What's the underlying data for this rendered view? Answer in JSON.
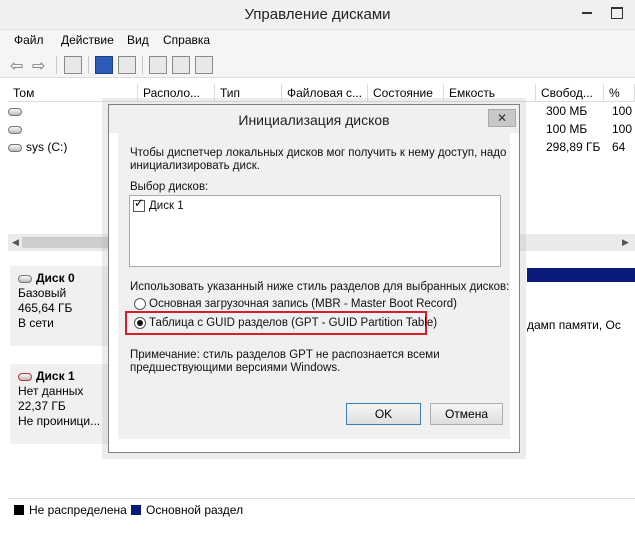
{
  "window": {
    "title": "Управление дисками"
  },
  "menu": [
    "Файл",
    "Действие",
    "Вид",
    "Справка"
  ],
  "columns": [
    "Том",
    "Располо...",
    "Тип",
    "Файловая с...",
    "Состояние",
    "Емкость",
    "Свобод...",
    "%"
  ],
  "volumes": [
    {
      "name": "",
      "free": "300 МБ",
      "pct": "100"
    },
    {
      "name": "",
      "free": "100 МБ",
      "pct": "100"
    },
    {
      "name": "sys (C:)",
      "free": "298,89 ГБ",
      "pct": "64"
    }
  ],
  "disks": [
    {
      "name": "Диск 0",
      "type": "Базовый",
      "size": "465,64 ГБ",
      "status": "В сети"
    },
    {
      "name": "Диск 1",
      "type": "Нет данных",
      "size": "22,37 ГБ",
      "status": "Не проиници..."
    }
  ],
  "partition_text": "дамп памяти, Ос",
  "legend": [
    {
      "label": "Не распределена",
      "color": "#000000"
    },
    {
      "label": "Основной раздел",
      "color": "#0a1a7a"
    }
  ],
  "dialog": {
    "title": "Инициализация дисков",
    "close": "✕",
    "intro_line1": "Чтобы диспетчер локальных дисков мог получить к нему доступ, надо",
    "intro_line2": "инициализировать диск.",
    "select_label": "Выбор дисков:",
    "disk_item": "Диск 1",
    "style_label": "Использовать указанный ниже стиль разделов для выбранных дисков:",
    "option_mbr": "Основная загрузочная запись (MBR - Master Boot Record)",
    "option_gpt": "Таблица с GUID разделов (GPT - GUID Partition Table)",
    "note_line1": "Примечание: стиль разделов GPT не распознается всеми",
    "note_line2": "предшествующими версиями Windows.",
    "ok": "OK",
    "cancel": "Отмена"
  },
  "accent_highlight": "#d4202a"
}
